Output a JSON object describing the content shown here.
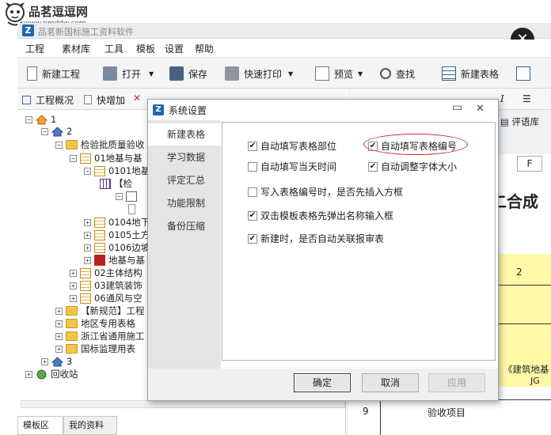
{
  "watermark": {
    "site_name": "品茗逗逗网",
    "url": "www.pmddw.com"
  },
  "app": {
    "title": "品茗新国标施工资料软件"
  },
  "menu": [
    "工程",
    "素材库",
    "工具",
    "模板",
    "设置",
    "帮助"
  ],
  "toolbar": {
    "new_project": "新建工程",
    "open": "打开",
    "save": "保存",
    "quick_print": "快速打印",
    "preview": "预览",
    "find": "查找",
    "new_table": "新建表格"
  },
  "left_panel": {
    "overview": "工程概况",
    "quick_add": "快增加",
    "tree": [
      {
        "label": "1"
      },
      {
        "label": "2"
      },
      {
        "label": "检验批质量验收"
      },
      {
        "label": "01地基与基"
      },
      {
        "label": "0101地基"
      },
      {
        "label": "【检"
      },
      {
        "label": ""
      },
      {
        "label": ""
      },
      {
        "label": "0104地下"
      },
      {
        "label": "0105土方"
      },
      {
        "label": "0106边坡"
      },
      {
        "label": "地基与基"
      },
      {
        "label": "02主体结构"
      },
      {
        "label": "03建筑装饰"
      },
      {
        "label": "06通风与空"
      },
      {
        "label": "【新规范】工程"
      },
      {
        "label": "地区专用表格"
      },
      {
        "label": "浙江省通用施工"
      },
      {
        "label": "国标监理用表"
      },
      {
        "label": "3"
      },
      {
        "label": "回收站"
      }
    ],
    "bottom_tabs": [
      "模板区",
      "我的资料"
    ]
  },
  "document": {
    "comment_lib": "评语库",
    "col_f": "F",
    "big_text": "二合成",
    "cell_2": "2",
    "cell_9": "9",
    "cell_items": "验收项目",
    "std_text": "《建筑地基",
    "std_text2": "JG"
  },
  "dialog": {
    "title": "系统设置",
    "sidebar": [
      "新建表格",
      "学习数据",
      "评定汇总",
      "功能限制",
      "备份压缩"
    ],
    "options": [
      {
        "label": "自动填写表格部位",
        "checked": true
      },
      {
        "label": "自动填写表格编号",
        "checked": true
      },
      {
        "label": "自动填写当天时间",
        "checked": false
      },
      {
        "label": "自动调整字体大小",
        "checked": true
      },
      {
        "label": "写入表格编号时，是否先插入方框",
        "checked": false
      },
      {
        "label": "双击模板表格先弹出名称输入框",
        "checked": true
      },
      {
        "label": "新建时，是否自动关联报审表",
        "checked": true
      }
    ],
    "buttons": {
      "ok": "确定",
      "cancel": "取消",
      "apply": "应用"
    },
    "accent_highlight": "#d42a2a"
  }
}
